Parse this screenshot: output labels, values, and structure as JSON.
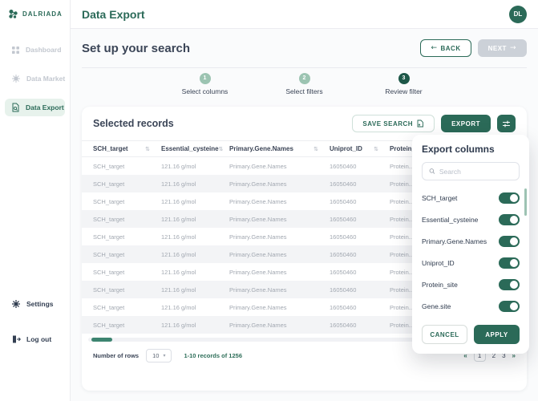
{
  "brand": {
    "name": "DALRIADA"
  },
  "sidebar": {
    "items": [
      {
        "label": "Dashboard",
        "icon": "grid-icon",
        "active": false
      },
      {
        "label": "Data Market",
        "icon": "molecule-icon",
        "active": false
      },
      {
        "label": "Data Export",
        "icon": "file-export-icon",
        "active": true
      }
    ],
    "footer_items": [
      {
        "label": "Settings",
        "icon": "gear-icon"
      },
      {
        "label": "Log out",
        "icon": "logout-icon"
      }
    ]
  },
  "header": {
    "title": "Data Export",
    "avatar": "DL"
  },
  "toolbar": {
    "heading": "Set up your search",
    "back_label": "BACK",
    "next_label": "NEXT",
    "back_arrow": "←",
    "next_arrow": "→"
  },
  "stepper": {
    "steps": [
      {
        "num": "1",
        "label": "Select columns",
        "state": "done"
      },
      {
        "num": "2",
        "label": "Select filters",
        "state": "done"
      },
      {
        "num": "3",
        "label": "Review filter",
        "state": "active"
      }
    ]
  },
  "records": {
    "title": "Selected records",
    "save_search_label": "SAVE SEARCH",
    "export_label": "EXPORT",
    "table": {
      "columns": [
        "SCH_target",
        "Essential_cysteine",
        "Primary.Gene.Names",
        "Uniprot_ID",
        "Protein_site"
      ],
      "sort_glyph": "⇅",
      "rows": [
        [
          "SCH_target",
          "121.16 g/mol",
          "Primary.Gene.Names",
          "16050460",
          "Protein..."
        ],
        [
          "SCH_target",
          "121.16 g/mol",
          "Primary.Gene.Names",
          "16050460",
          "Protein..."
        ],
        [
          "SCH_target",
          "121.16 g/mol",
          "Primary.Gene.Names",
          "16050460",
          "Protein..."
        ],
        [
          "SCH_target",
          "121.16 g/mol",
          "Primary.Gene.Names",
          "16050460",
          "Protein..."
        ],
        [
          "SCH_target",
          "121.16 g/mol",
          "Primary.Gene.Names",
          "16050460",
          "Protein..."
        ],
        [
          "SCH_target",
          "121.16 g/mol",
          "Primary.Gene.Names",
          "16050460",
          "Protein..."
        ],
        [
          "SCH_target",
          "121.16 g/mol",
          "Primary.Gene.Names",
          "16050460",
          "Protein..."
        ],
        [
          "SCH_target",
          "121.16 g/mol",
          "Primary.Gene.Names",
          "16050460",
          "Protein..."
        ],
        [
          "SCH_target",
          "121.16 g/mol",
          "Primary.Gene.Names",
          "16050460",
          "Protein..."
        ],
        [
          "SCH_target",
          "121.16 g/mol",
          "Primary.Gene.Names",
          "16050460",
          "Protein..."
        ]
      ]
    },
    "footer": {
      "rows_label": "Number of rows",
      "rows_value": "10",
      "records_info": "1-10 records of 1256",
      "pagination": {
        "prev": "«",
        "pages": [
          "1",
          "2",
          "3"
        ],
        "next": "»",
        "current": "1"
      }
    }
  },
  "export_panel": {
    "title": "Export columns",
    "search_placeholder": "Search",
    "toggles": [
      {
        "label": "SCH_target",
        "on": true
      },
      {
        "label": "Essential_cysteine",
        "on": true
      },
      {
        "label": "Primary.Gene.Names",
        "on": true
      },
      {
        "label": "Uniprot_ID",
        "on": true
      },
      {
        "label": "Protein_site",
        "on": true
      },
      {
        "label": "Gene.site",
        "on": true
      }
    ],
    "cancel_label": "CANCEL",
    "apply_label": "APPLY"
  },
  "colors": {
    "primary": "#2b6a58",
    "primary_dark": "#1d5748",
    "sage": "#9cc4b2",
    "active_item_bg": "#e7f2ec",
    "navy_text": "#3b4557",
    "muted_text": "#a2a8b1",
    "row_stripe": "#f3f4f6",
    "disabled_btn": "#ccd1d8"
  }
}
